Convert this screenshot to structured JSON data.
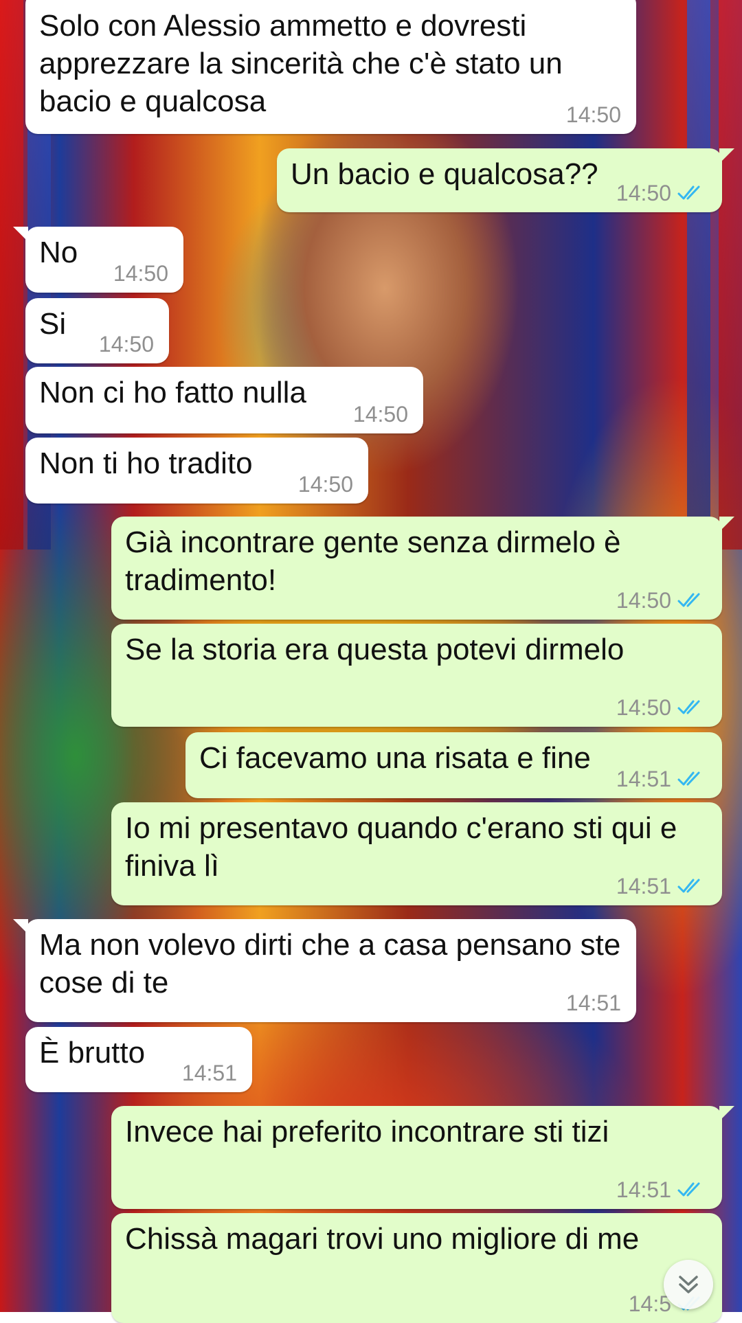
{
  "chat": {
    "messages": [
      {
        "dir": "in",
        "text": "Solo con Alessio ammetto e dovresti apprezzare la sincerità che c'è stato un bacio e qualcosa",
        "time": "14:50"
      },
      {
        "dir": "out",
        "text": "Un bacio e qualcosa??",
        "time": "14:50",
        "status": "read"
      },
      {
        "dir": "in",
        "text": "No",
        "time": "14:50"
      },
      {
        "dir": "in",
        "text": "Si",
        "time": "14:50"
      },
      {
        "dir": "in",
        "text": "Non ci ho fatto nulla",
        "time": "14:50"
      },
      {
        "dir": "in",
        "text": "Non ti ho tradito",
        "time": "14:50"
      },
      {
        "dir": "out",
        "text": "Già incontrare gente senza dirmelo è tradimento!",
        "time": "14:50",
        "status": "read"
      },
      {
        "dir": "out",
        "text": "Se la storia era questa potevi dirmelo",
        "time": "14:50",
        "status": "read"
      },
      {
        "dir": "out",
        "text": "Ci facevamo una risata e fine",
        "time": "14:51",
        "status": "read"
      },
      {
        "dir": "out",
        "text": "Io mi presentavo quando c'erano sti qui e finiva lì",
        "time": "14:51",
        "status": "read"
      },
      {
        "dir": "in",
        "text": "Ma non volevo dirti che a casa pensano ste cose di te",
        "time": "14:51"
      },
      {
        "dir": "in",
        "text": "È brutto",
        "time": "14:51"
      },
      {
        "dir": "out",
        "text": "Invece hai preferito incontrare sti tizi",
        "time": "14:51",
        "status": "read"
      },
      {
        "dir": "out",
        "text": "Chissà magari trovi uno migliore di me",
        "time": "14:5",
        "status": "read"
      }
    ]
  },
  "colors": {
    "incoming_bubble": "#ffffff",
    "outgoing_bubble": "#e2fdca",
    "read_ticks": "#34b7f1",
    "timestamp": "#8f8f8f"
  },
  "icons": {
    "read_status": "double-check-icon",
    "scroll_down": "chevron-double-down-icon"
  }
}
